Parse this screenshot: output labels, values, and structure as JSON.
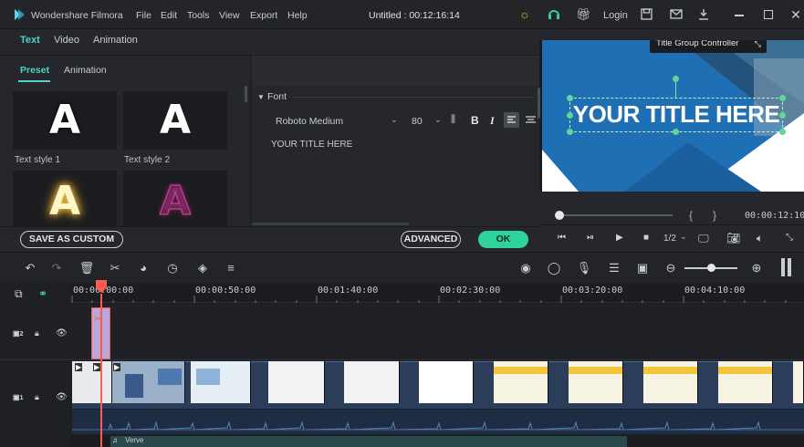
{
  "app": {
    "name": "Wondershare Filmora",
    "project": "Untitled : 00:12:16:14"
  },
  "menu": [
    "File",
    "Edit",
    "Tools",
    "View",
    "Export",
    "Help"
  ],
  "titlebar": {
    "login": "Login"
  },
  "editor_tabs": [
    "Text",
    "Video",
    "Animation"
  ],
  "sub_tabs": [
    "Preset",
    "Animation"
  ],
  "presets": [
    {
      "label": "Text style 1"
    },
    {
      "label": "Text style 2"
    },
    {
      "label": ""
    },
    {
      "label": ""
    }
  ],
  "font_section": {
    "title": "Font",
    "font_name": "Roboto Medium",
    "font_size": "80",
    "text_value": "YOUR TITLE HERE"
  },
  "buttons": {
    "save_custom": "SAVE AS CUSTOM",
    "advanced": "ADVANCED",
    "ok": "OK"
  },
  "preview": {
    "tooltip": "Title Group Controller",
    "title_text": "YOUR TITLE HERE",
    "timecode": "00:00:12:10",
    "bracket_in": "{",
    "bracket_out": "}",
    "quality": "1/2"
  },
  "timeline": {
    "ruler": [
      "00:00:00:00",
      "00:00:50:00",
      "00:01:40:00",
      "00:02:30:00",
      "00:03:20:00",
      "00:04:10:00"
    ],
    "audio_clip": "Verve",
    "track2_label": "2",
    "track1_label": "1"
  },
  "colors": {
    "accent": "#4fd2c8",
    "playhead": "#ff5a4f",
    "preview_blue": "#1e73b8",
    "ok_green": "#2ed39b"
  }
}
